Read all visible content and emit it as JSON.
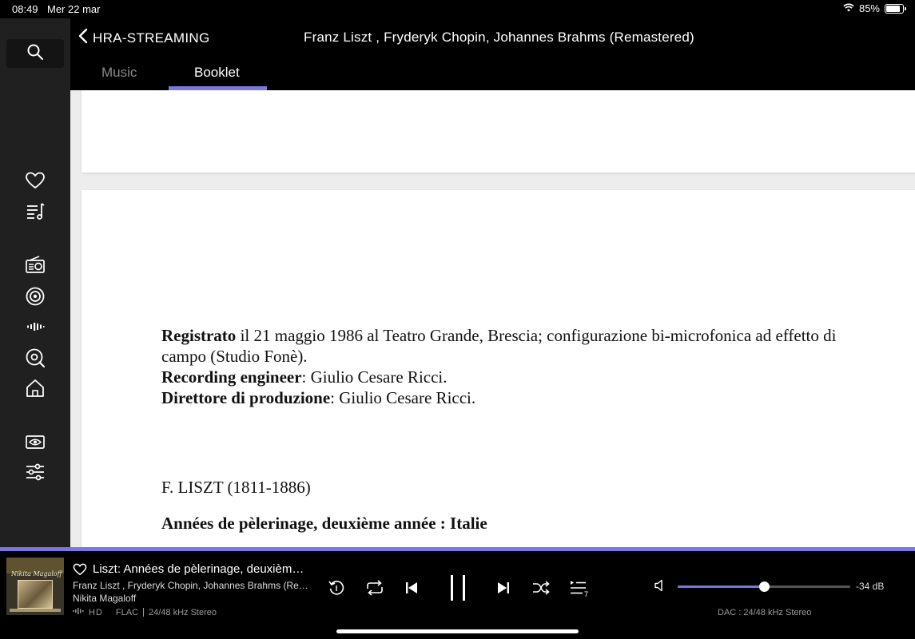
{
  "status_bar": {
    "time": "08:49",
    "date": "Mer 22 mar",
    "battery": "85%",
    "battery_level": 0.85
  },
  "sidebar": {
    "items": [
      {
        "icon": "search-icon"
      },
      {
        "icon": "heart-icon"
      },
      {
        "icon": "playlist-icon"
      },
      {
        "icon": "radio-icon"
      },
      {
        "icon": "podcast-icon"
      },
      {
        "icon": "waveform-icon"
      },
      {
        "icon": "discover-icon"
      },
      {
        "icon": "home-icon"
      },
      {
        "icon": "eye-icon"
      },
      {
        "icon": "settings-sliders-icon"
      }
    ]
  },
  "header": {
    "back_label": "HRA-STREAMING",
    "album_title": "Franz Liszt , Fryderyk Chopin, Johannes Brahms (Remastered)",
    "tabs": [
      {
        "label": "Music",
        "active": false
      },
      {
        "label": "Booklet",
        "active": true
      }
    ]
  },
  "booklet": {
    "recorded_label": "Registrato",
    "recorded_text": " il 21 maggio 1986 al Teatro Grande, Brescia; configurazione bi-microfonica ad effetto di campo (Studio Fonè).",
    "engineer_label": "Recording engineer",
    "engineer_text": ": Giulio Cesare Ricci.",
    "director_label": "Direttore di produzione",
    "director_text": ": Giulio Cesare Ricci.",
    "composer": "F. LISZT (1811-1886)",
    "work_title": "Années de pèlerinage, deuxième année : Italie"
  },
  "player": {
    "cover_text": "Nikita Magaloff",
    "track_title": "Liszt: Années de pèlerinage, deuxième année : Italie",
    "track_artists": "Franz Liszt , Fryderyk Chopin, Johannes Brahms (Remastered)",
    "performer": "Nikita Magaloff",
    "hd_label": "HD",
    "format": "FLAC",
    "quality": "24/48 kHz Stereo",
    "queue_count": "7",
    "volume_fraction": 0.5,
    "volume_db": "-34 dB",
    "dac": "DAC : 24/48 kHz Stereo",
    "accent_color": "#7b76e0"
  }
}
